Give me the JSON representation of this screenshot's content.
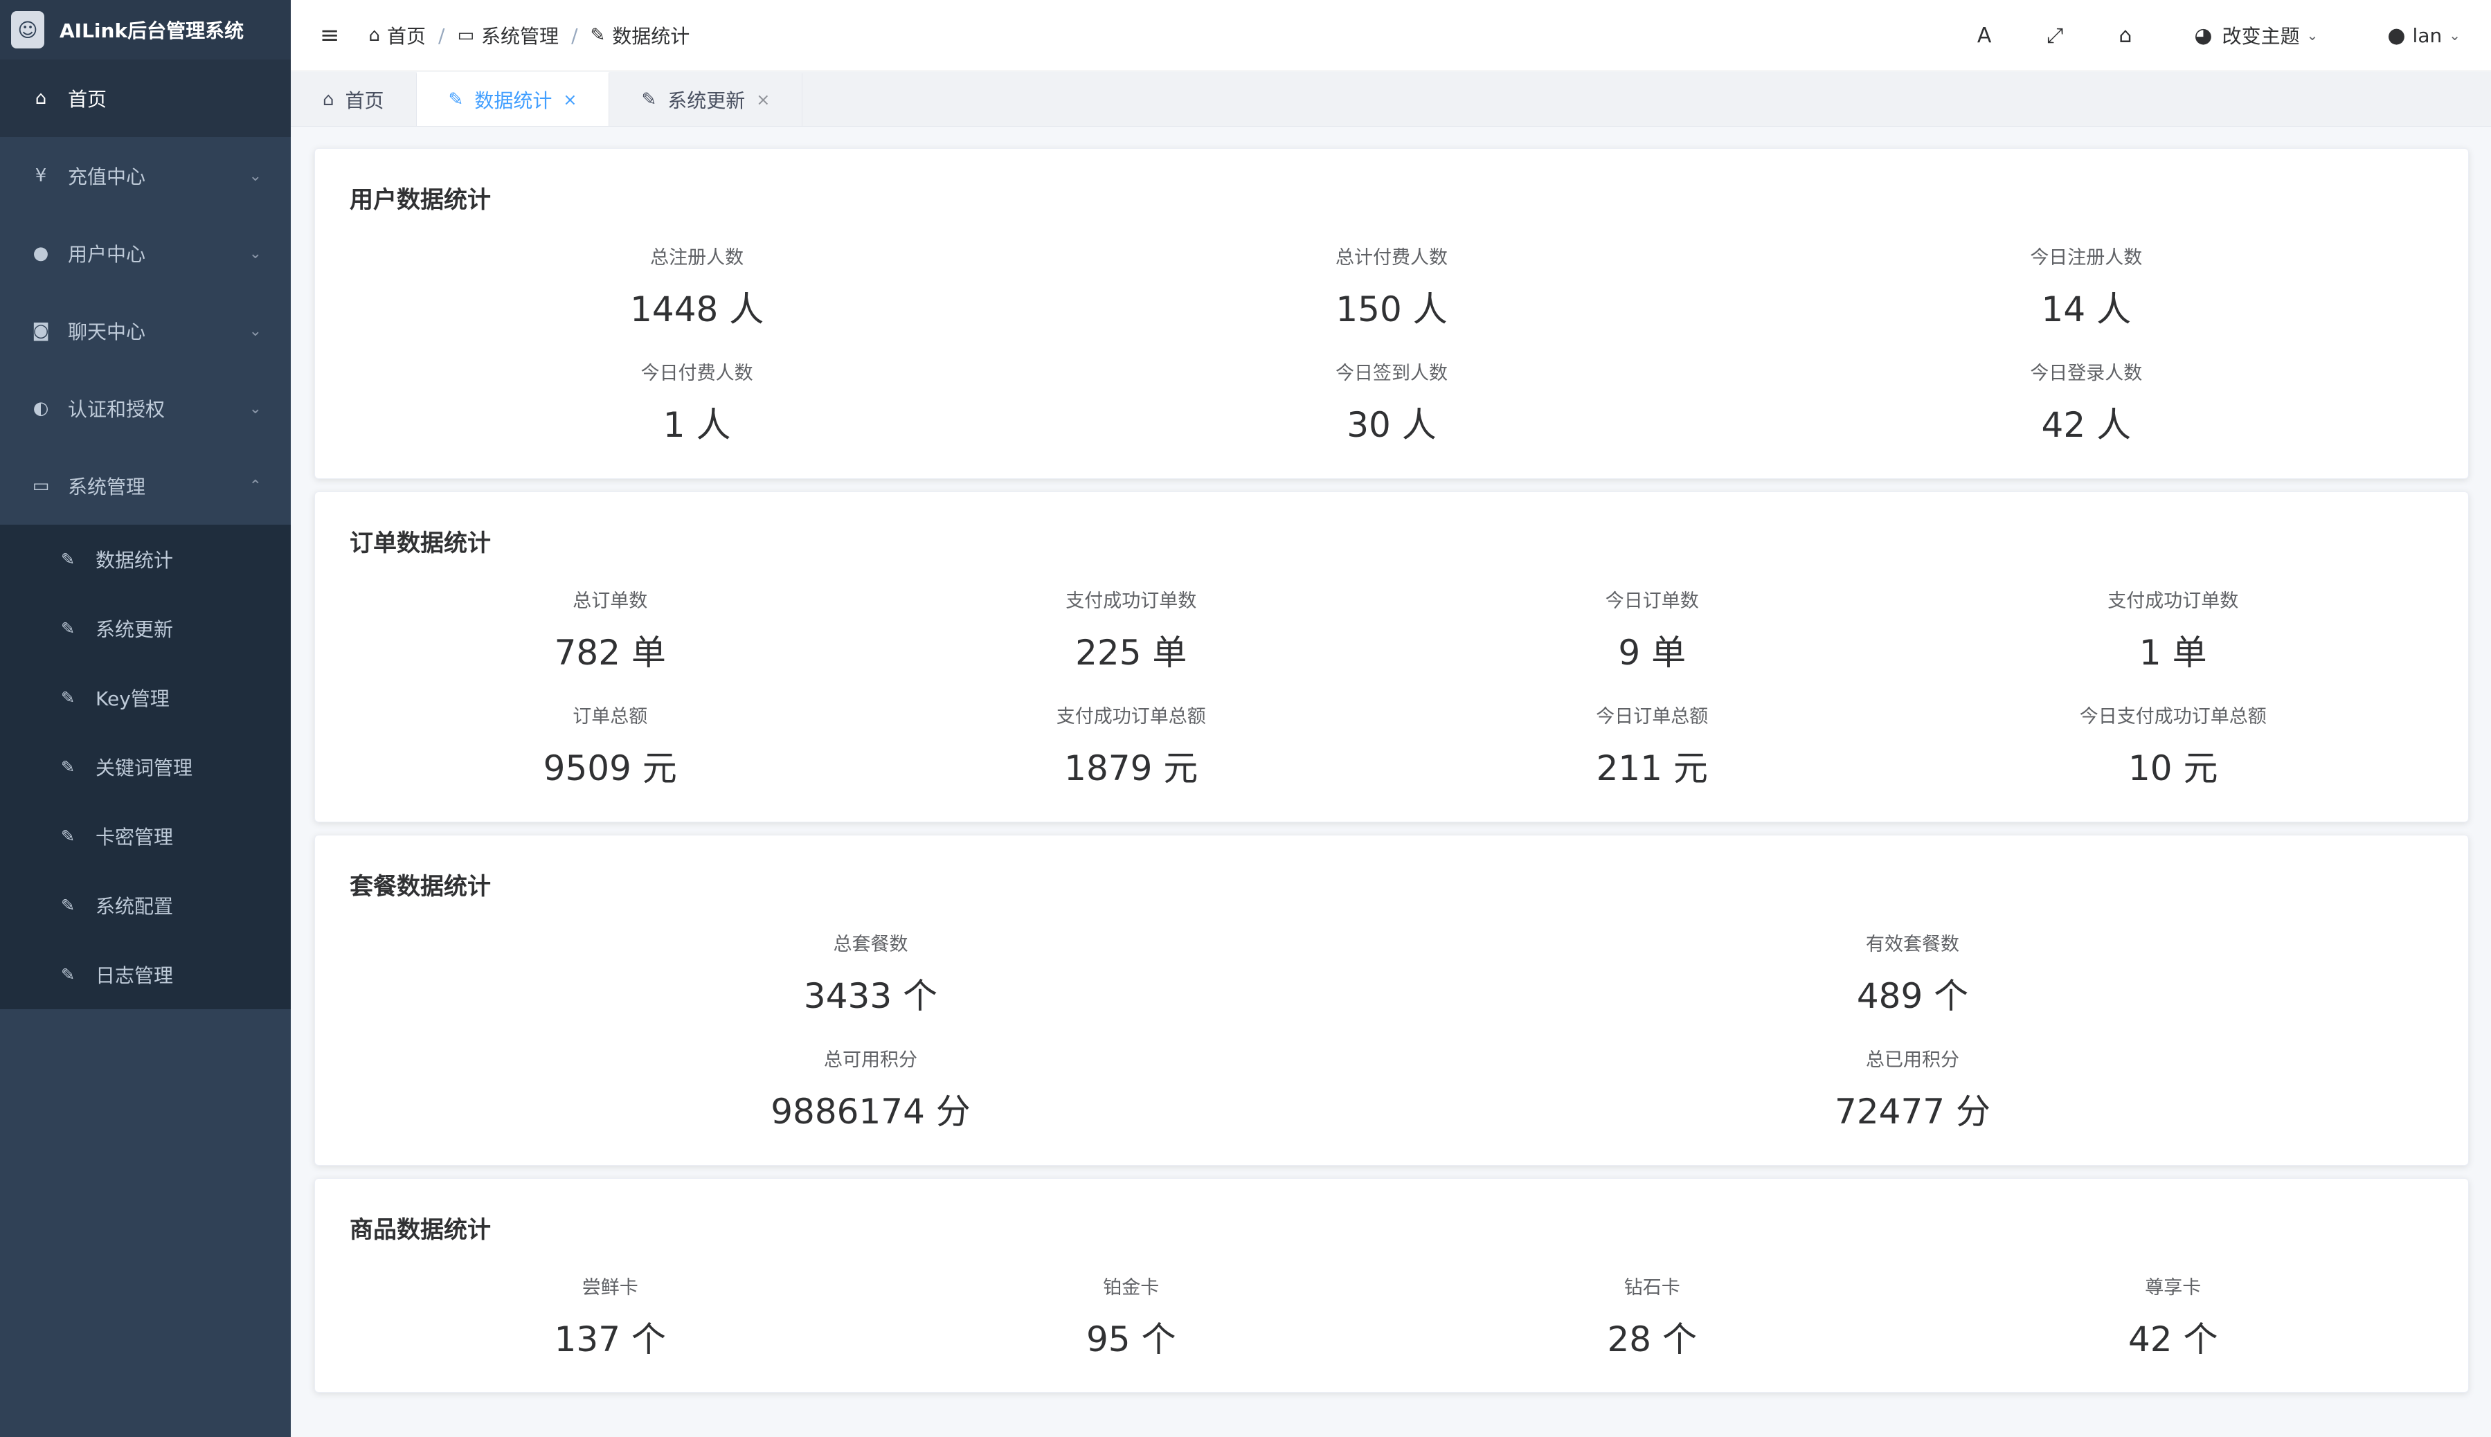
{
  "app": {
    "title": "AILink后台管理系统"
  },
  "sidebar": {
    "items": [
      {
        "label": "首页",
        "icon": "home-icon"
      },
      {
        "label": "充值中心",
        "icon": "yen-icon"
      },
      {
        "label": "用户中心",
        "icon": "user-icon"
      },
      {
        "label": "聊天中心",
        "icon": "chat-icon"
      },
      {
        "label": "认证和授权",
        "icon": "shield-icon"
      },
      {
        "label": "系统管理",
        "icon": "monitor-icon"
      }
    ],
    "sub_items": [
      {
        "label": "数据统计",
        "icon": "wrench-icon"
      },
      {
        "label": "系统更新",
        "icon": "wrench-icon"
      },
      {
        "label": "Key管理",
        "icon": "wrench-icon"
      },
      {
        "label": "关键词管理",
        "icon": "wrench-icon"
      },
      {
        "label": "卡密管理",
        "icon": "wrench-icon"
      },
      {
        "label": "系统配置",
        "icon": "wrench-icon"
      },
      {
        "label": "日志管理",
        "icon": "wrench-icon"
      }
    ]
  },
  "breadcrumb": [
    "首页",
    "系统管理",
    "数据统计"
  ],
  "topbar": {
    "theme_label": "改变主题",
    "user_label": "lan"
  },
  "tabs": [
    {
      "label": "首页",
      "active": false
    },
    {
      "label": "数据统计",
      "active": true
    },
    {
      "label": "系统更新",
      "active": false
    }
  ],
  "sections": {
    "user": {
      "title": "用户数据统计",
      "stats": [
        {
          "label": "总注册人数",
          "value": "1448 人"
        },
        {
          "label": "总计付费人数",
          "value": "150 人"
        },
        {
          "label": "今日注册人数",
          "value": "14 人"
        },
        {
          "label": "今日付费人数",
          "value": "1 人"
        },
        {
          "label": "今日签到人数",
          "value": "30 人"
        },
        {
          "label": "今日登录人数",
          "value": "42 人"
        }
      ]
    },
    "order": {
      "title": "订单数据统计",
      "stats": [
        {
          "label": "总订单数",
          "value": "782 单"
        },
        {
          "label": "支付成功订单数",
          "value": "225 单"
        },
        {
          "label": "今日订单数",
          "value": "9 单"
        },
        {
          "label": "支付成功订单数",
          "value": "1 单"
        },
        {
          "label": "订单总额",
          "value": "9509 元"
        },
        {
          "label": "支付成功订单总额",
          "value": "1879 元"
        },
        {
          "label": "今日订单总额",
          "value": "211 元"
        },
        {
          "label": "今日支付成功订单总额",
          "value": "10 元"
        }
      ]
    },
    "package": {
      "title": "套餐数据统计",
      "stats": [
        {
          "label": "总套餐数",
          "value": "3433 个"
        },
        {
          "label": "有效套餐数",
          "value": "489 个"
        },
        {
          "label": "总可用积分",
          "value": "9886174 分"
        },
        {
          "label": "总已用积分",
          "value": "72477 分"
        }
      ]
    },
    "goods": {
      "title": "商品数据统计",
      "stats": [
        {
          "label": "尝鲜卡",
          "value": "137 个"
        },
        {
          "label": "铂金卡",
          "value": "95 个"
        },
        {
          "label": "钻石卡",
          "value": "28 个"
        },
        {
          "label": "尊享卡",
          "value": "42 个"
        }
      ]
    }
  },
  "colors": {
    "sidebar_bg": "#304156",
    "accent": "#409eff"
  }
}
